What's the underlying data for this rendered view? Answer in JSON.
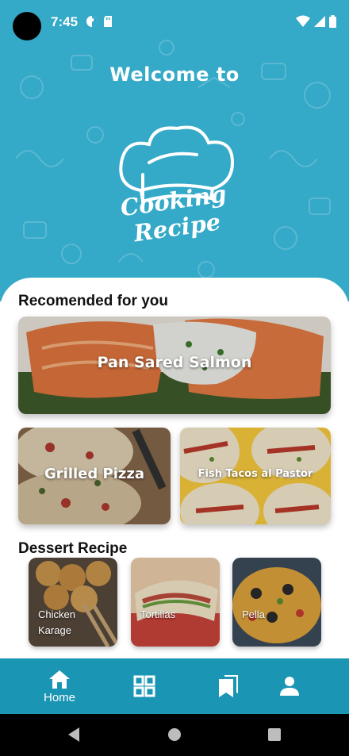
{
  "status_bar": {
    "time": "7:45"
  },
  "header": {
    "welcome": "Welcome to",
    "logo_text": "Cooking Recipe",
    "colors": {
      "background": "#35a9c8",
      "nav": "#1a95b4"
    }
  },
  "recommended": {
    "title": "Recomended for you",
    "items": [
      {
        "label": "Pan Sared Salmon"
      },
      {
        "label": "Grilled Pizza"
      },
      {
        "label": "Fish Tacos al Pastor"
      }
    ]
  },
  "dessert": {
    "title": "Dessert Recipe",
    "items": [
      {
        "label": "Chicken Karage"
      },
      {
        "label": "Tortillas"
      },
      {
        "label": "Pella"
      }
    ]
  },
  "bottom_nav": {
    "items": [
      {
        "label": "Home",
        "icon": "home-icon",
        "active": true
      },
      {
        "label": "",
        "icon": "grid-icon"
      },
      {
        "label": "",
        "icon": "bookmarks-icon"
      },
      {
        "label": "",
        "icon": "person-icon"
      }
    ]
  },
  "system_nav": {
    "icons": [
      "back-icon",
      "home-circle-icon",
      "recents-icon"
    ]
  }
}
